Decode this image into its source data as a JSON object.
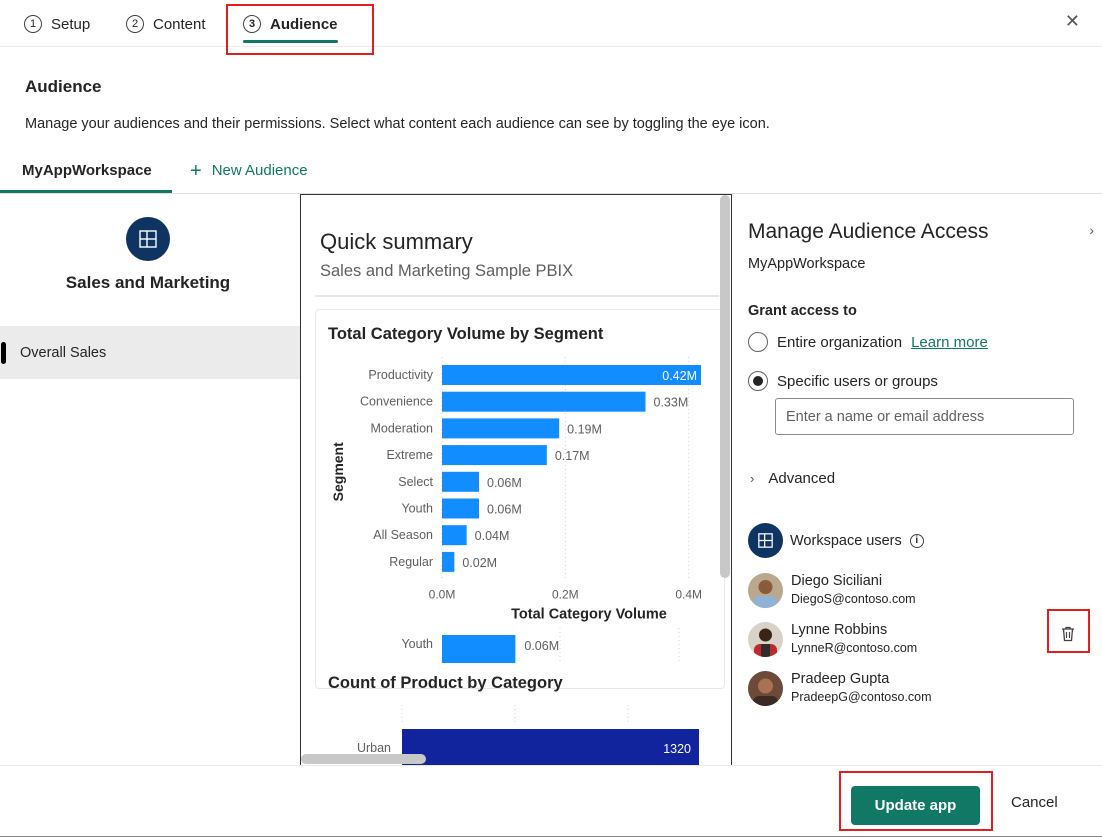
{
  "stepper": {
    "steps": [
      {
        "num": "1",
        "label": "Setup"
      },
      {
        "num": "2",
        "label": "Content"
      },
      {
        "num": "3",
        "label": "Audience",
        "active": true
      }
    ],
    "close_icon": "close-icon"
  },
  "header": {
    "title": "Audience",
    "description": "Manage your audiences and their permissions. Select what content each audience can see by toggling the eye icon."
  },
  "audience_tabs": {
    "active": "MyAppWorkspace",
    "new_label": "New Audience",
    "new_icon": "plus-icon"
  },
  "left_nav": {
    "app_name": "Sales and Marketing",
    "items": [
      {
        "label": "Overall Sales",
        "selected": true
      }
    ]
  },
  "preview": {
    "title": "Quick summary",
    "subtitle": "Sales and Marketing Sample PBIX"
  },
  "chart_data": [
    {
      "type": "bar",
      "orientation": "horizontal",
      "title": "Total Category Volume by Segment",
      "categories": [
        "Productivity",
        "Convenience",
        "Moderation",
        "Extreme",
        "Select",
        "Youth",
        "All Season",
        "Regular"
      ],
      "values": [
        0.42,
        0.33,
        0.19,
        0.17,
        0.06,
        0.06,
        0.04,
        0.02
      ],
      "labels": [
        "0.42M",
        "0.33M",
        "0.19M",
        "0.17M",
        "0.06M",
        "0.06M",
        "0.04M",
        "0.02M"
      ],
      "xlabel": "Total Category Volume",
      "ylabel": "Segment",
      "xticks": [
        "0.0M",
        "0.2M",
        "0.4M"
      ],
      "xlim": [
        0,
        0.42
      ],
      "grid": true,
      "color": "#118dff"
    },
    {
      "type": "bar",
      "orientation": "horizontal",
      "title": "",
      "categories": [
        "Youth"
      ],
      "values": [
        0.06
      ],
      "labels": [
        "0.06M"
      ],
      "xlim": [
        0,
        0.18
      ],
      "color": "#118dff",
      "note": "partially visible duplicate visual"
    },
    {
      "type": "bar",
      "orientation": "horizontal",
      "title": "Count of Product by Category",
      "categories": [
        "Urban"
      ],
      "values": [
        1320
      ],
      "labels": [
        "1320"
      ],
      "color": "#12239e"
    }
  ],
  "right_panel": {
    "title": "Manage Audience Access",
    "subtitle": "MyAppWorkspace",
    "grant_label": "Grant access to",
    "options": [
      {
        "label": "Entire organization",
        "selected": false,
        "link": "Learn more"
      },
      {
        "label": "Specific users or groups",
        "selected": true
      }
    ],
    "input_placeholder": "Enter a name or email address",
    "advanced_label": "Advanced",
    "workspace_users_label": "Workspace users",
    "users": [
      {
        "name": "Diego Siciliani",
        "email": "DiegoS@contoso.com"
      },
      {
        "name": "Lynne Robbins",
        "email": "LynneR@contoso.com",
        "delete_visible": true
      },
      {
        "name": "Pradeep Gupta",
        "email": "PradeepG@contoso.com"
      }
    ]
  },
  "footer": {
    "primary_label": "Update app",
    "cancel_label": "Cancel"
  },
  "colors": {
    "accent": "#117865",
    "logo_bg": "#0f3462",
    "highlight": "#e02020"
  }
}
